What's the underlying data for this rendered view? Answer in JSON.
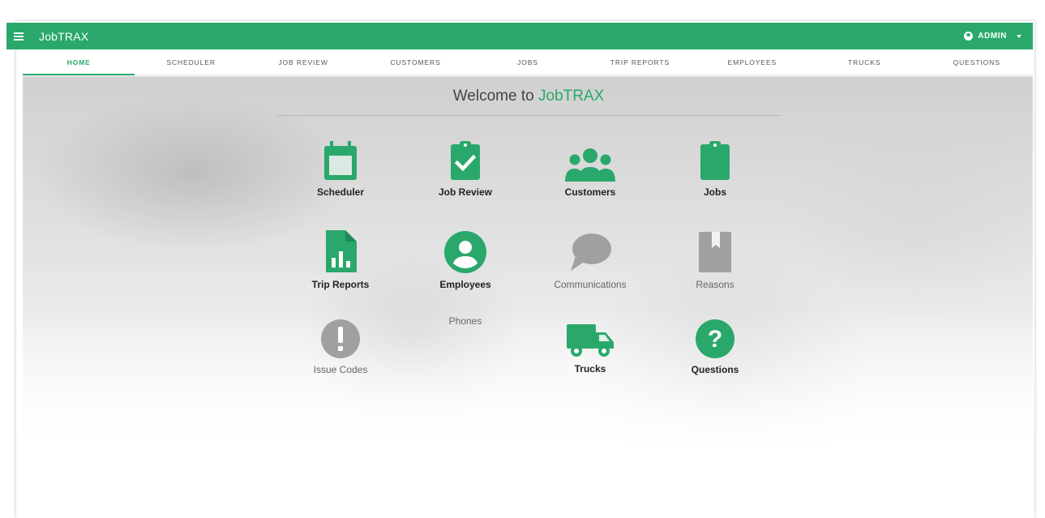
{
  "header": {
    "app_title": "JobTRAX",
    "user_label": "ADMIN"
  },
  "tabs": [
    {
      "label": "HOME",
      "active": true
    },
    {
      "label": "SCHEDULER"
    },
    {
      "label": "JOB REVIEW"
    },
    {
      "label": "CUSTOMERS"
    },
    {
      "label": "JOBS"
    },
    {
      "label": "TRIP REPORTS"
    },
    {
      "label": "EMPLOYEES"
    },
    {
      "label": "TRUCKS"
    },
    {
      "label": "QUESTIONS"
    }
  ],
  "welcome": {
    "prefix": "Welcome to ",
    "brand": "JobTRAX"
  },
  "tiles": [
    {
      "label": "Scheduler",
      "icon": "calendar-icon",
      "color": "#2aa86b"
    },
    {
      "label": "Job Review",
      "icon": "clipboard-check-icon",
      "color": "#2aa86b"
    },
    {
      "label": "Customers",
      "icon": "users-icon",
      "color": "#2aa86b"
    },
    {
      "label": "Jobs",
      "icon": "clipboard-icon",
      "color": "#2aa86b"
    },
    {
      "label": "Trip Reports",
      "icon": "report-chart-icon",
      "color": "#2aa86b"
    },
    {
      "label": "Employees",
      "icon": "account-circle-icon",
      "color": "#2aa86b"
    },
    {
      "label": "Communications",
      "icon": "chat-bubble-icon",
      "color": "#a0a0a0"
    },
    {
      "label": "Reasons",
      "icon": "bookmark-book-icon",
      "color": "#a0a0a0"
    },
    {
      "label": "Issue Codes",
      "icon": "alert-circle-icon",
      "color": "#a0a0a0"
    },
    {
      "label": "Phones",
      "icon": "",
      "color": "#666666"
    },
    {
      "label": "Trucks",
      "icon": "truck-icon",
      "color": "#2aa86b"
    },
    {
      "label": "Questions",
      "icon": "question-circle-icon",
      "color": "#2aa86b"
    }
  ],
  "colors": {
    "accent": "#2aa86b",
    "disabled": "#a0a0a0"
  }
}
